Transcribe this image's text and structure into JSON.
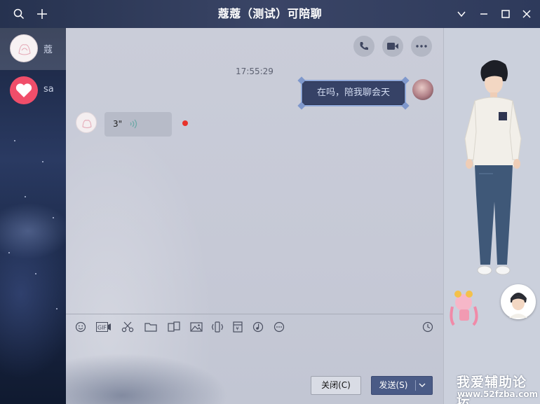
{
  "window": {
    "title": "蔻蔻（测试）可陪聊",
    "controls": [
      "search-icon",
      "add-icon",
      "chevron-down-icon",
      "minimize-icon",
      "maximize-icon",
      "close-icon"
    ]
  },
  "sessions": [
    {
      "name": "蔻",
      "active": true
    },
    {
      "name": "sa",
      "active": false
    }
  ],
  "chat": {
    "top_actions": [
      "phone-icon",
      "video-icon",
      "more-icon"
    ],
    "timestamp": "17:55:29",
    "messages": [
      {
        "direction": "out",
        "type": "text",
        "text": "在吗，陪我聊会天"
      },
      {
        "direction": "in",
        "type": "voice",
        "duration": "3\"",
        "unread": true
      }
    ],
    "toolbar": [
      "emoji-icon",
      "gif-icon",
      "scissors-icon",
      "folder-icon",
      "file-transfer-icon",
      "image-icon",
      "shake-icon",
      "red-packet-icon",
      "music-icon",
      "more-icon",
      "history-icon"
    ],
    "buttons": {
      "close_label": "关闭(C)",
      "send_label": "发送(S)"
    }
  },
  "watermark": {
    "line1": "我爱辅助论坛",
    "line2": "www.52fzba.com"
  },
  "colors": {
    "accent": "#4a5b86",
    "unread": "#e8322b",
    "heart": "#f04e6a"
  }
}
